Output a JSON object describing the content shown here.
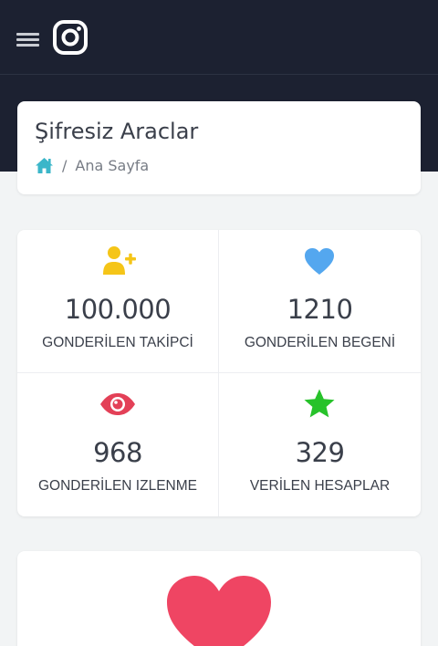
{
  "header": {
    "menu_icon": "hamburger-menu-icon",
    "logo_icon": "instagram-logo-icon"
  },
  "page": {
    "title": "Şifresiz Araclar",
    "breadcrumb": {
      "home_icon": "home-icon",
      "separator": "/",
      "current": "Ana Sayfa"
    }
  },
  "stats": [
    {
      "icon": "user-plus-icon",
      "value": "100.000",
      "label": "GONDERİLEN TAKİPCİ",
      "color": "#f5c518"
    },
    {
      "icon": "heart-icon",
      "value": "1210",
      "label": "GONDERİLEN BEGENİ",
      "color": "#54a7ef"
    },
    {
      "icon": "eye-icon",
      "value": "968",
      "label": "GONDERİLEN IZLENME",
      "color": "#e34057"
    },
    {
      "icon": "star-icon",
      "value": "329",
      "label": "VERİLEN HESAPLAR",
      "color": "#27c22a"
    }
  ],
  "colors": {
    "header_bg": "#1c2131",
    "accent_home": "#3bb6c9",
    "big_heart": "#ef4563"
  }
}
